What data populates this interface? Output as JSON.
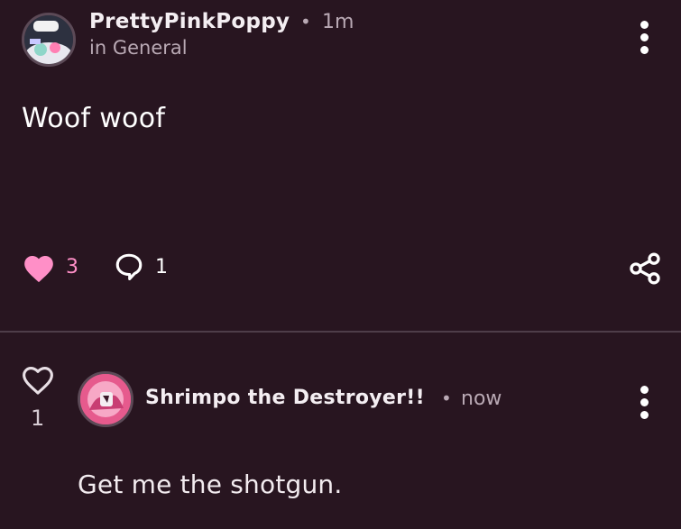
{
  "post": {
    "author": "PrettyPinkPoppy",
    "time": "1m",
    "community": "in General",
    "separator": "•",
    "body": "Woof woof",
    "likes": "3",
    "comments": "1",
    "liked": true,
    "icons": {
      "avatar": "avatar",
      "menu": "more-vertical-icon",
      "like": "heart-filled-icon",
      "comment": "comment-bubble-icon",
      "share": "share-icon"
    }
  },
  "comment": {
    "author": "Shrimpo the Destroyer!!",
    "time": "now",
    "separator": "•",
    "body": "Get me the shotgun.",
    "likes": "1",
    "liked": false,
    "icons": {
      "like": "heart-outline-icon",
      "menu": "more-vertical-icon"
    }
  },
  "colors": {
    "background": "#281520",
    "accent_pink": "#ff8fc7",
    "muted_text": "#b9a9b4",
    "divider": "#4e3d49"
  }
}
